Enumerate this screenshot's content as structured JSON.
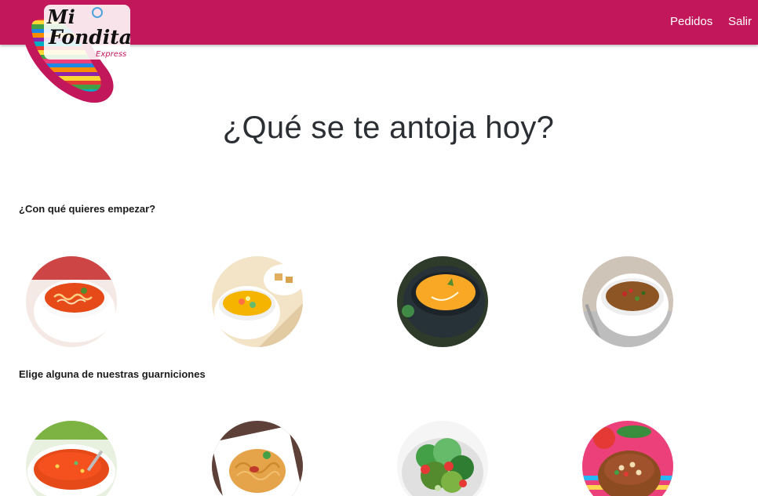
{
  "nav": {
    "links": [
      {
        "label": "Pedidos"
      },
      {
        "label": "Salir"
      }
    ]
  },
  "logo": {
    "text_line1": "Mi",
    "text_line2": "Fondita",
    "text_line3": "Express"
  },
  "page": {
    "title": "¿Qué se te antoja hoy?"
  },
  "sections": [
    {
      "title": "¿Con qué quieres empezar?",
      "items": [
        {
          "icon": "tomato-noodle-soup"
        },
        {
          "icon": "vegetable-broth"
        },
        {
          "icon": "pumpkin-cream-soup"
        },
        {
          "icon": "bean-soup"
        }
      ]
    },
    {
      "title": "Elige alguna de nuestras guarniciones",
      "items": [
        {
          "icon": "mexican-rice"
        },
        {
          "icon": "spaghetti"
        },
        {
          "icon": "green-salad"
        },
        {
          "icon": "charro-beans"
        }
      ]
    }
  ],
  "colors": {
    "brand": "#c2185b",
    "text": "#212529"
  }
}
